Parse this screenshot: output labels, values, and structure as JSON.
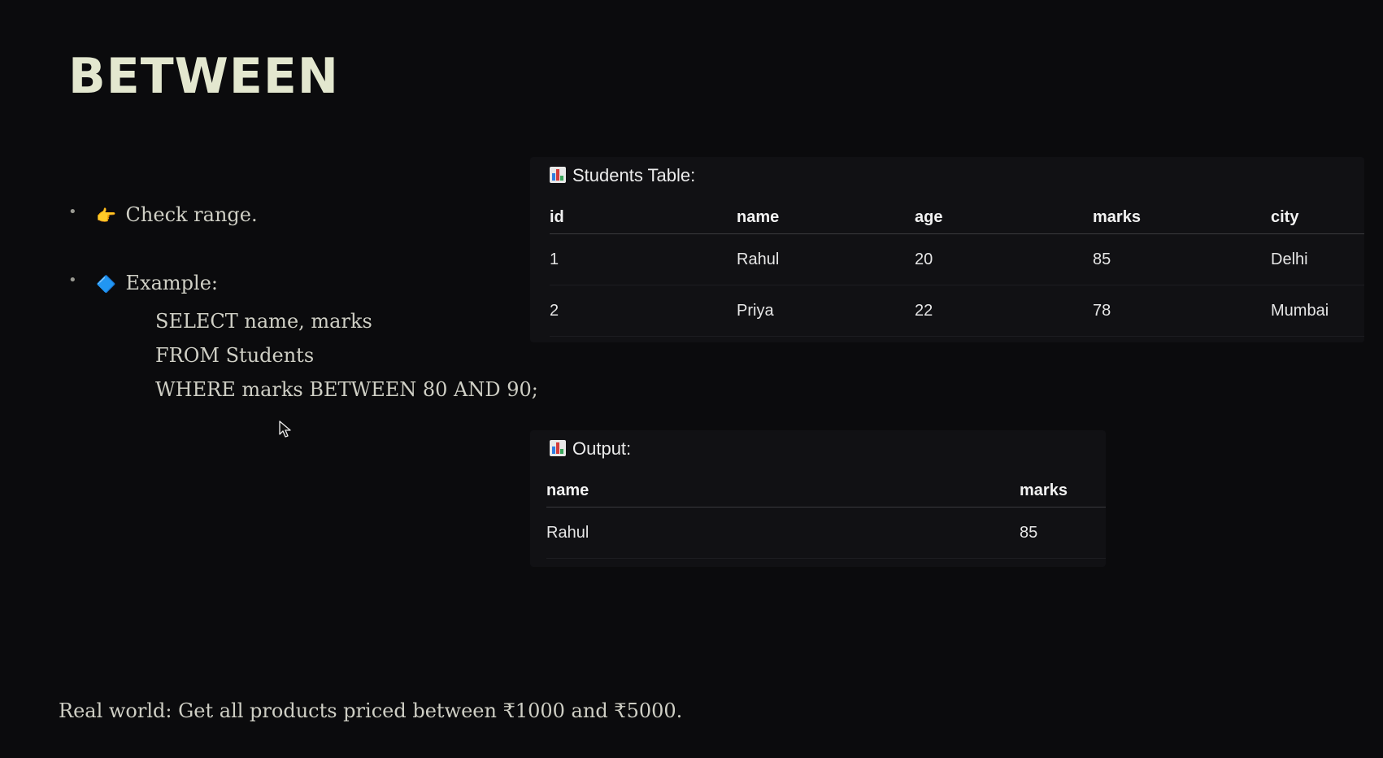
{
  "slide": {
    "title": "BETWEEN",
    "bullets": [
      {
        "icon": "pointing-hand-icon",
        "emoji": "👉",
        "text": "Check range."
      },
      {
        "icon": "blue-diamond-icon",
        "emoji": "🔷",
        "text": "Example:"
      }
    ],
    "code_lines": [
      "SELECT name, marks",
      "FROM Students",
      "WHERE marks BETWEEN 80 AND 90;"
    ],
    "footer": "Real world: Get all products priced between ₹1000 and ₹5000."
  },
  "students_table": {
    "caption": "Students Table:",
    "icon": "bar-chart-icon",
    "headers": [
      "id",
      "name",
      "age",
      "marks",
      "city"
    ],
    "rows": [
      [
        "1",
        "Rahul",
        "20",
        "85",
        "Delhi"
      ],
      [
        "2",
        "Priya",
        "22",
        "78",
        "Mumbai"
      ]
    ]
  },
  "output_table": {
    "caption": "Output:",
    "icon": "bar-chart-icon",
    "headers": [
      "name",
      "marks"
    ],
    "rows": [
      [
        "Rahul",
        "85"
      ]
    ]
  },
  "colors": {
    "background": "#0b0b0d",
    "title": "#e3e7cf",
    "panel": "#111114"
  }
}
